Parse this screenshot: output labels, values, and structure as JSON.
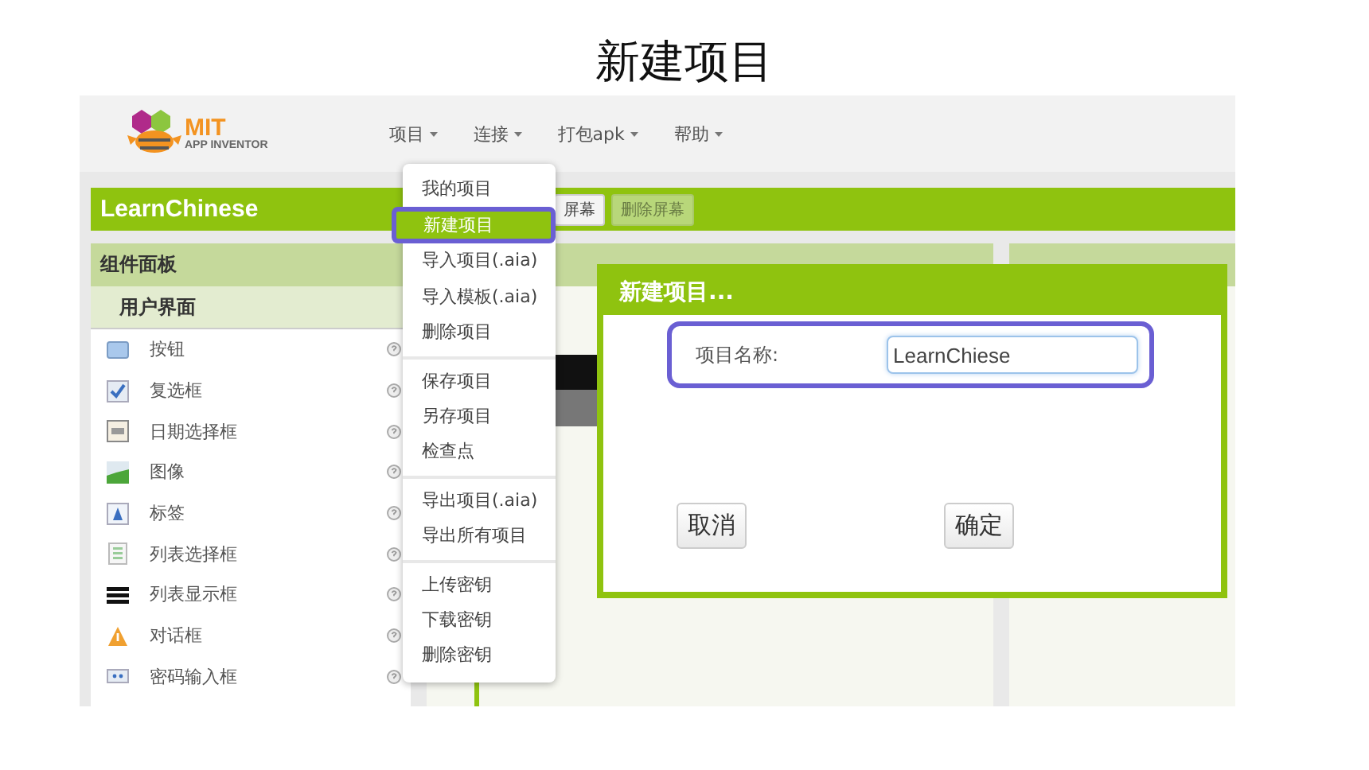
{
  "slide_title": "新建项目",
  "logo": {
    "title": "MIT",
    "subtitle": "APP INVENTOR"
  },
  "top_menus": [
    "项目",
    "连接",
    "打包apk",
    "帮助"
  ],
  "project_bar": {
    "name": "LearnChinese",
    "buttons": [
      {
        "label": "屏幕",
        "disabled": false
      },
      {
        "label": "删除屏幕",
        "disabled": true
      }
    ]
  },
  "palette": {
    "title": "组件面板",
    "category": "用户界面",
    "items": [
      {
        "label": "按钮",
        "kind": "button"
      },
      {
        "label": "复选框",
        "kind": "checkbox"
      },
      {
        "label": "日期选择框",
        "kind": "date"
      },
      {
        "label": "图像",
        "kind": "image"
      },
      {
        "label": "标签",
        "kind": "label"
      },
      {
        "label": "列表选择框",
        "kind": "listpicker"
      },
      {
        "label": "列表显示框",
        "kind": "listview"
      },
      {
        "label": "对话框",
        "kind": "notifier"
      },
      {
        "label": "密码输入框",
        "kind": "password"
      }
    ]
  },
  "project_menu": {
    "groups": [
      [
        {
          "label": "我的项目",
          "selected": false
        },
        {
          "label": "新建项目",
          "selected": true
        },
        {
          "label": "导入项目(.aia)",
          "selected": false
        },
        {
          "label": "导入模板(.aia)",
          "selected": false
        },
        {
          "label": "删除项目",
          "selected": false
        }
      ],
      [
        {
          "label": "保存项目",
          "selected": false
        },
        {
          "label": "另存项目",
          "selected": false
        },
        {
          "label": "检查点",
          "selected": false
        }
      ],
      [
        {
          "label": "导出项目(.aia)",
          "selected": false
        },
        {
          "label": "导出所有项目",
          "selected": false
        }
      ],
      [
        {
          "label": "上传密钥",
          "selected": false
        },
        {
          "label": "下载密钥",
          "selected": false
        },
        {
          "label": "删除密钥",
          "selected": false
        }
      ]
    ]
  },
  "dialog": {
    "title": "新建项目...",
    "field_label": "项目名称:",
    "value": "LearnChiese",
    "field_highlighted": true,
    "buttons": [
      "取消",
      "确定"
    ]
  }
}
